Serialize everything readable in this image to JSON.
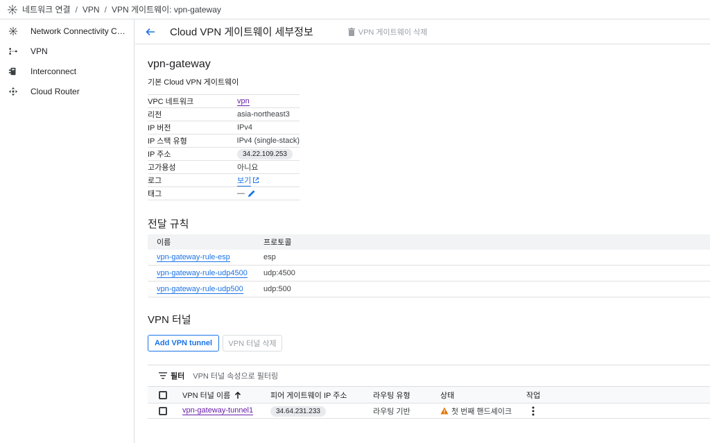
{
  "breadcrumb": {
    "items": [
      "네트워크 연결",
      "VPN",
      "VPN 게이트웨이: vpn-gateway"
    ],
    "separator": "/"
  },
  "sidebar": {
    "items": [
      {
        "label": "Network Connectivity Cen...",
        "icon": "network-hub-icon"
      },
      {
        "label": "VPN",
        "icon": "vpn-icon"
      },
      {
        "label": "Interconnect",
        "icon": "interconnect-icon"
      },
      {
        "label": "Cloud Router",
        "icon": "router-icon"
      }
    ]
  },
  "header": {
    "title": "Cloud VPN 게이트웨이 세부정보",
    "delete_label": "VPN 게이트웨이 삭제"
  },
  "gateway": {
    "name": "vpn-gateway",
    "subtitle": "기본 Cloud VPN 게이트웨이",
    "props": [
      {
        "key": "VPC 네트워크",
        "value": "vpn"
      },
      {
        "key": "리전",
        "value": "asia-northeast3"
      },
      {
        "key": "IP 버전",
        "value": "IPv4"
      },
      {
        "key": "IP 스택 유형",
        "value": "IPv4 (single-stack)"
      },
      {
        "key": "IP 주소",
        "value": "34.22.109.253"
      },
      {
        "key": "고가용성",
        "value": "아니요"
      },
      {
        "key": "로그",
        "value": "보기"
      },
      {
        "key": "태그",
        "value": "—"
      }
    ]
  },
  "forwarding": {
    "title": "전달 규칙",
    "columns": [
      "이름",
      "프로토콜"
    ],
    "rows": [
      {
        "name": "vpn-gateway-rule-esp",
        "protocol": "esp"
      },
      {
        "name": "vpn-gateway-rule-udp4500",
        "protocol": "udp:4500"
      },
      {
        "name": "vpn-gateway-rule-udp500",
        "protocol": "udp:500"
      }
    ]
  },
  "tunnels": {
    "title": "VPN 터널",
    "add_label": "Add VPN tunnel",
    "delete_label": "VPN 터널 삭제",
    "filter_label": "필터",
    "filter_placeholder": "VPN 터널 속성으로 필터링",
    "columns": [
      "VPN 터널 이름",
      "피어 게이트웨이 IP 주소",
      "라우팅 유형",
      "상태",
      "작업"
    ],
    "rows": [
      {
        "name": "vpn-gateway-tunnel1",
        "peer_ip": "34.64.231.233",
        "routing": "라우팅 기반",
        "status": "첫 번째 핸드셰이크"
      }
    ]
  },
  "colors": {
    "accent": "#1a73e8",
    "visited": "#681da8",
    "warning": "#e37400"
  }
}
